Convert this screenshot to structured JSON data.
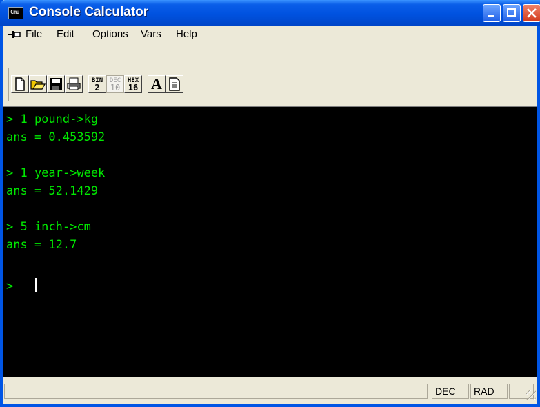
{
  "window": {
    "title": "Console Calculator",
    "icon_text": "Cmu"
  },
  "menu": {
    "items": [
      "File",
      "Edit",
      "Options",
      "Vars",
      "Help"
    ]
  },
  "toolbar": {
    "buttons": [
      "new-file-icon",
      "open-folder-icon",
      "save-disk-icon",
      "print-icon",
      "bin-base",
      "dec-base",
      "hex-base",
      "font-icon",
      "variables-list-icon"
    ],
    "bin": {
      "label": "BIN",
      "num": "2"
    },
    "dec": {
      "label": "DEC",
      "num": "10"
    },
    "hex": {
      "label": "HEX",
      "num": "16"
    },
    "font_glyph": "A"
  },
  "console": {
    "lines": [
      "> 1 pound->kg",
      "ans = 0.453592",
      "",
      "> 1 year->week",
      "ans = 52.1429",
      "",
      "> 5 inch->cm",
      "ans = 12.7",
      "",
      ">"
    ],
    "text_color": "#00e800",
    "background": "#000000"
  },
  "status": {
    "mode": "DEC",
    "angle": "RAD"
  }
}
